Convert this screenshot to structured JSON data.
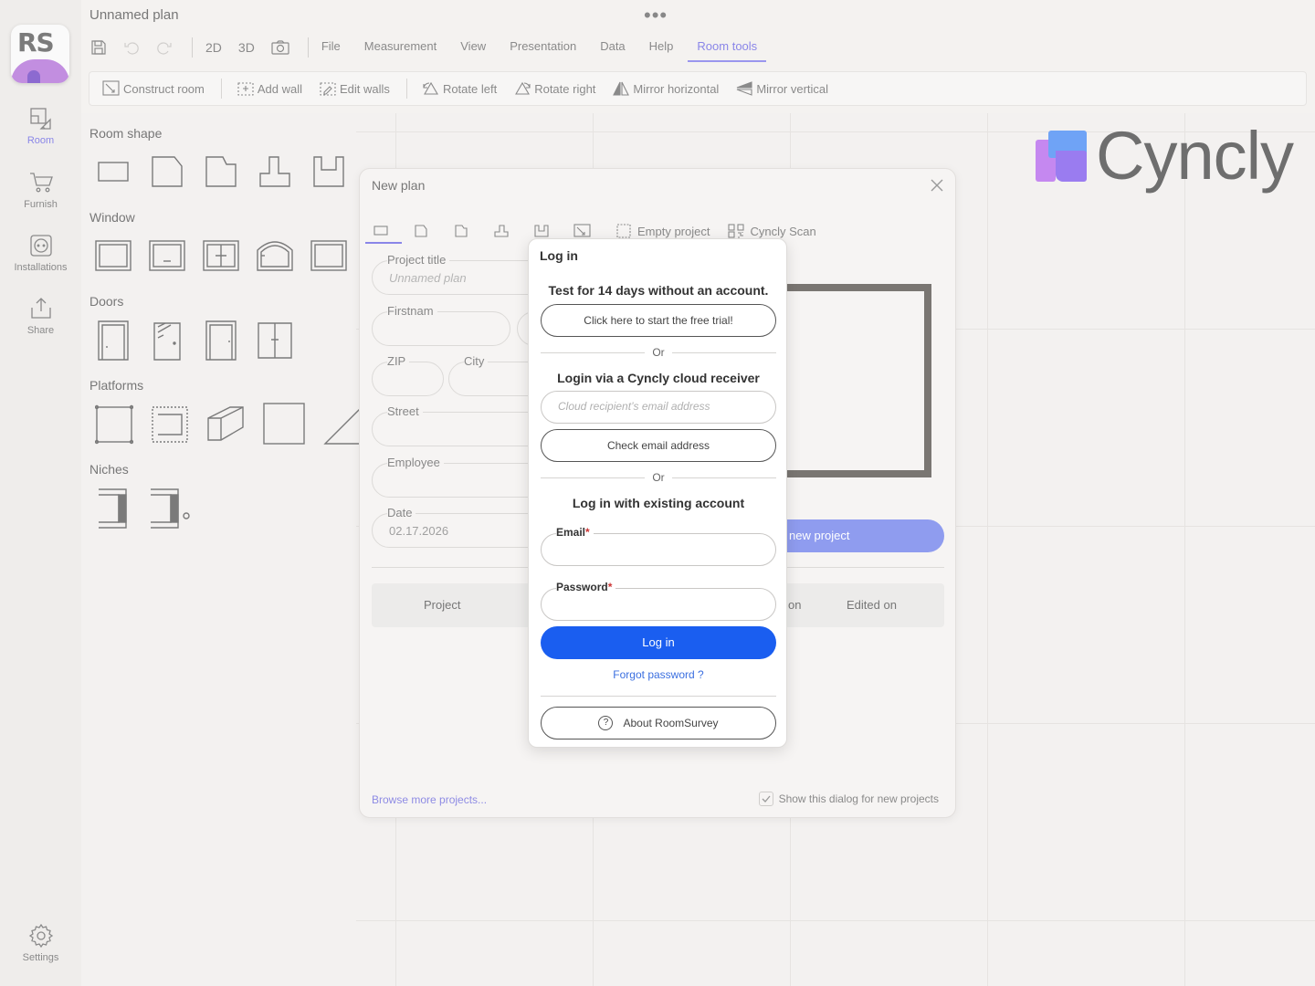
{
  "window": {
    "title": "Unnamed plan"
  },
  "app": {
    "logo_text": "RS"
  },
  "sidebar": {
    "items": [
      {
        "label": "Room",
        "icon": "room-icon",
        "active": true
      },
      {
        "label": "Furnish",
        "icon": "cart-icon"
      },
      {
        "label": "Installations",
        "icon": "outlet-icon"
      },
      {
        "label": "Share",
        "icon": "share-icon"
      }
    ],
    "settings_label": "Settings"
  },
  "topbar": {
    "view_2d": "2D",
    "view_3d": "3D",
    "menu": [
      "File",
      "Measurement",
      "View",
      "Presentation",
      "Data",
      "Help",
      "Room tools"
    ],
    "active_menu": "Room tools"
  },
  "toolbar": {
    "tools": [
      "Construct room",
      "Add wall",
      "Edit walls",
      "Rotate left",
      "Rotate right",
      "Mirror horizontal",
      "Mirror vertical"
    ]
  },
  "panel": {
    "sections": [
      "Room shape",
      "Window",
      "Doors",
      "Platforms",
      "Niches"
    ]
  },
  "brand": {
    "name": "Cyncly"
  },
  "new_plan": {
    "title": "New plan",
    "tabs": [
      "Empty project",
      "Cyncly Scan"
    ],
    "fields": {
      "project_title_label": "Project title",
      "project_title_placeholder": "Unnamed plan",
      "firstname_label": "Firstnam",
      "zip_label": "ZIP",
      "city_label": "City",
      "street_label": "Street",
      "employee_label": "Employee",
      "date_label": "Date",
      "date_value": "02.17.2026"
    },
    "create_button": "new project",
    "list_columns": [
      "Project",
      "on",
      "Edited on"
    ],
    "browse_link": "Browse more projects...",
    "show_dialog_label": "Show this dialog for new projects"
  },
  "login": {
    "title": "Log in",
    "trial_heading": "Test for 14 days without an account.",
    "trial_button": "Click here to start the free trial!",
    "or": "Or",
    "cloud_heading": "Login via a Cyncly cloud receiver",
    "cloud_placeholder": "Cloud recipient’s email address",
    "check_email_button": "Check email address",
    "existing_heading": "Log in with existing account",
    "email_label": "Email",
    "password_label": "Password",
    "required_mark": "*",
    "login_button": "Log in",
    "forgot_link": "Forgot password ?",
    "about_button": "About RoomSurvey",
    "about_icon_glyph": "?"
  },
  "colors": {
    "accent": "#8a86e8",
    "primary_button": "#1a5ef0",
    "link": "#3b6fe0"
  }
}
